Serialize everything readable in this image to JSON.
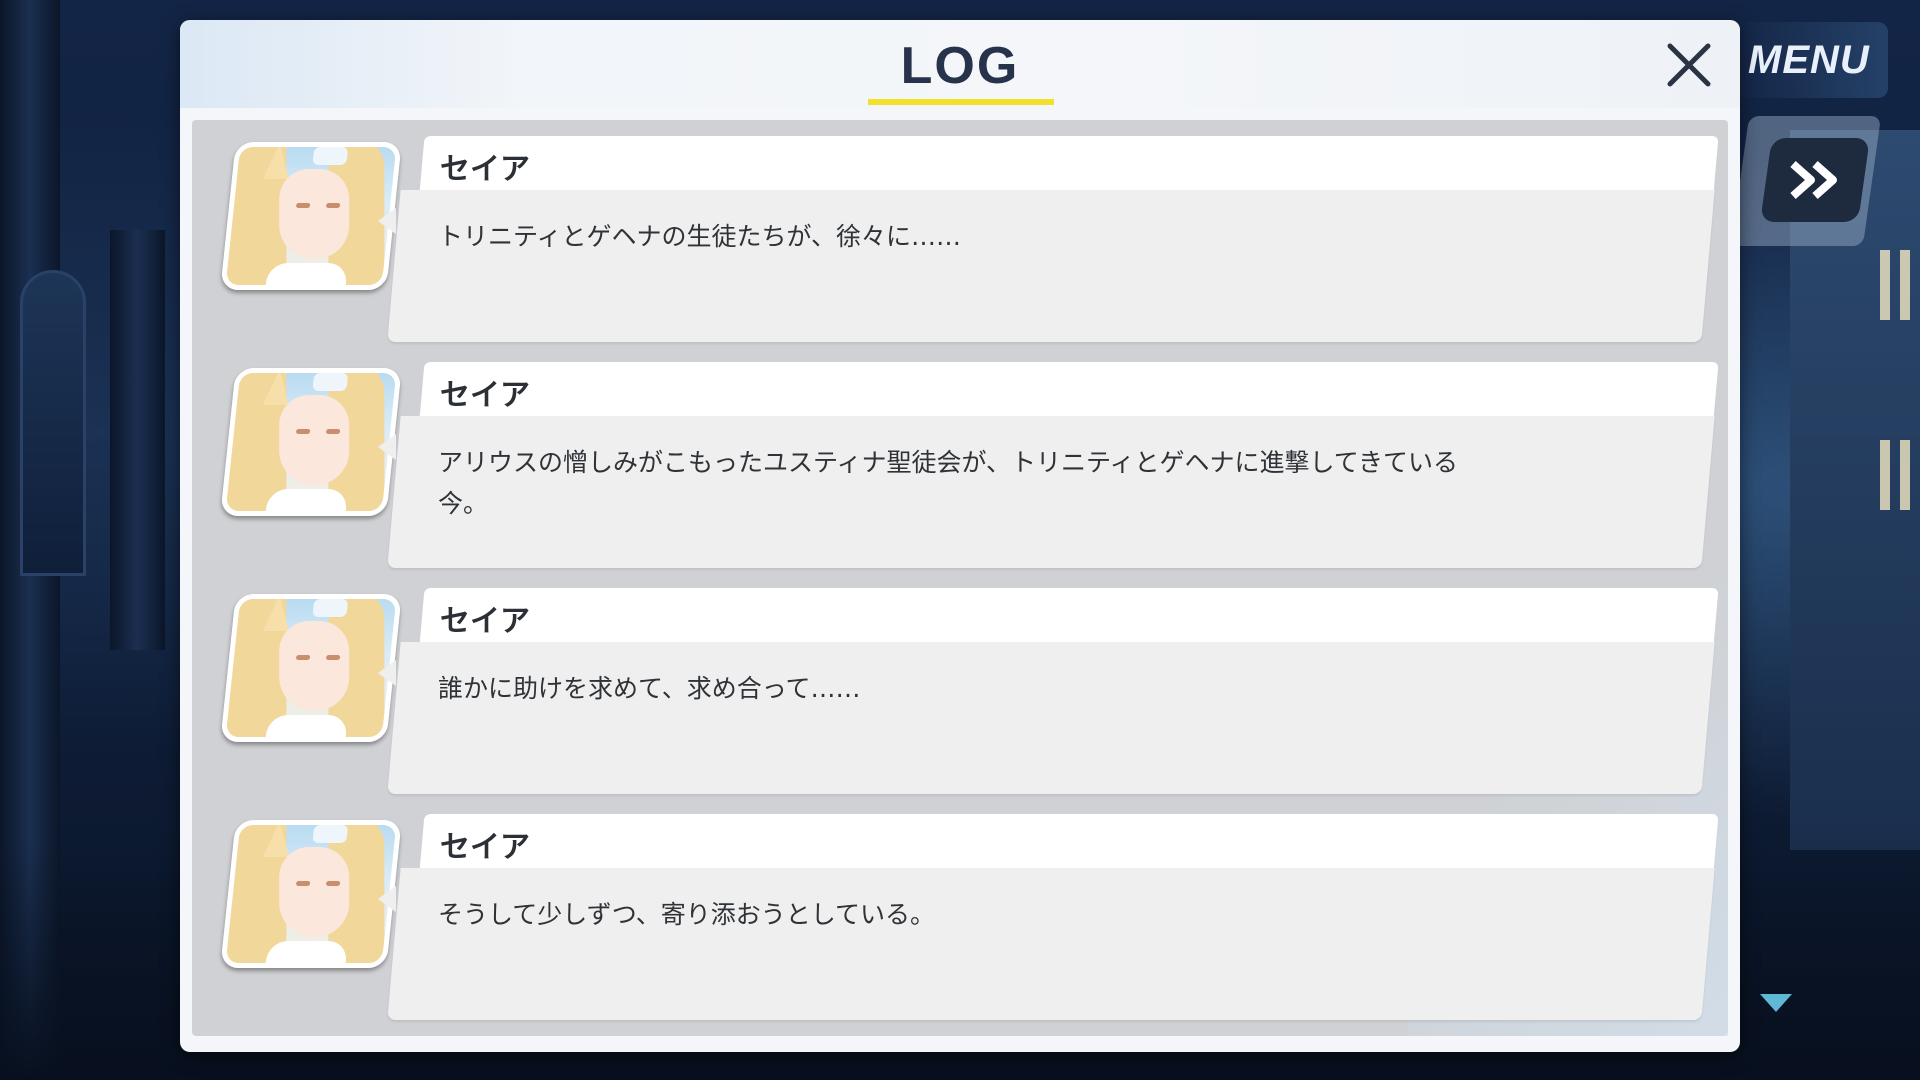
{
  "header": {
    "title": "LOG"
  },
  "hud": {
    "menu_label": "MENU"
  },
  "entries": [
    {
      "speaker": "セイア",
      "text": "トリニティとゲヘナの生徒たちが、徐々に……"
    },
    {
      "speaker": "セイア",
      "text": "アリウスの憎しみがこもったユスティナ聖徒会が、トリニティとゲヘナに進撃してきている今。"
    },
    {
      "speaker": "セイア",
      "text": "誰かに助けを求めて、求め合って……"
    },
    {
      "speaker": "セイア",
      "text": "そうして少しずつ、寄り添おうとしている。"
    }
  ],
  "icons": {
    "close": "close-icon",
    "skip": "fast-forward-icon",
    "scroll": "scroll-down-arrow-icon"
  },
  "colors": {
    "title_underline": "#f3df2e",
    "title_text": "#26334a",
    "panel_bg": "#f4f6f9",
    "bubble_bg": "#efefef"
  }
}
